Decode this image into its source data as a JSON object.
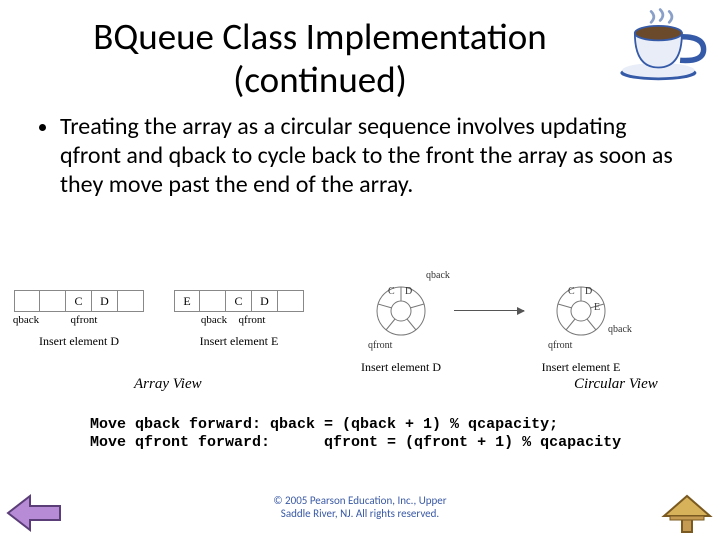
{
  "title_line1": "BQueue Class Implementation",
  "title_line2": "(continued)",
  "bullet_text": "Treating the array as a circular sequence involves updating qfront and qback to cycle back to the front the array as soon as they move past the end of the array.",
  "labels": {
    "qback": "qback",
    "qfront": "qfront",
    "insert_d": "Insert element D",
    "insert_e": "Insert  element E",
    "array_view": "Array View",
    "circular_view": "Circular View",
    "c": "C",
    "d": "D",
    "e": "E"
  },
  "code_line1": "Move qback forward: qback = (qback + 1) % qcapacity;",
  "code_line2": "Move qfront forward:      qfront = (qfront + 1) % qcapacity",
  "footer_line1": "© 2005 Pearson Education, Inc., Upper",
  "footer_line2": "Saddle River, NJ. All rights reserved."
}
